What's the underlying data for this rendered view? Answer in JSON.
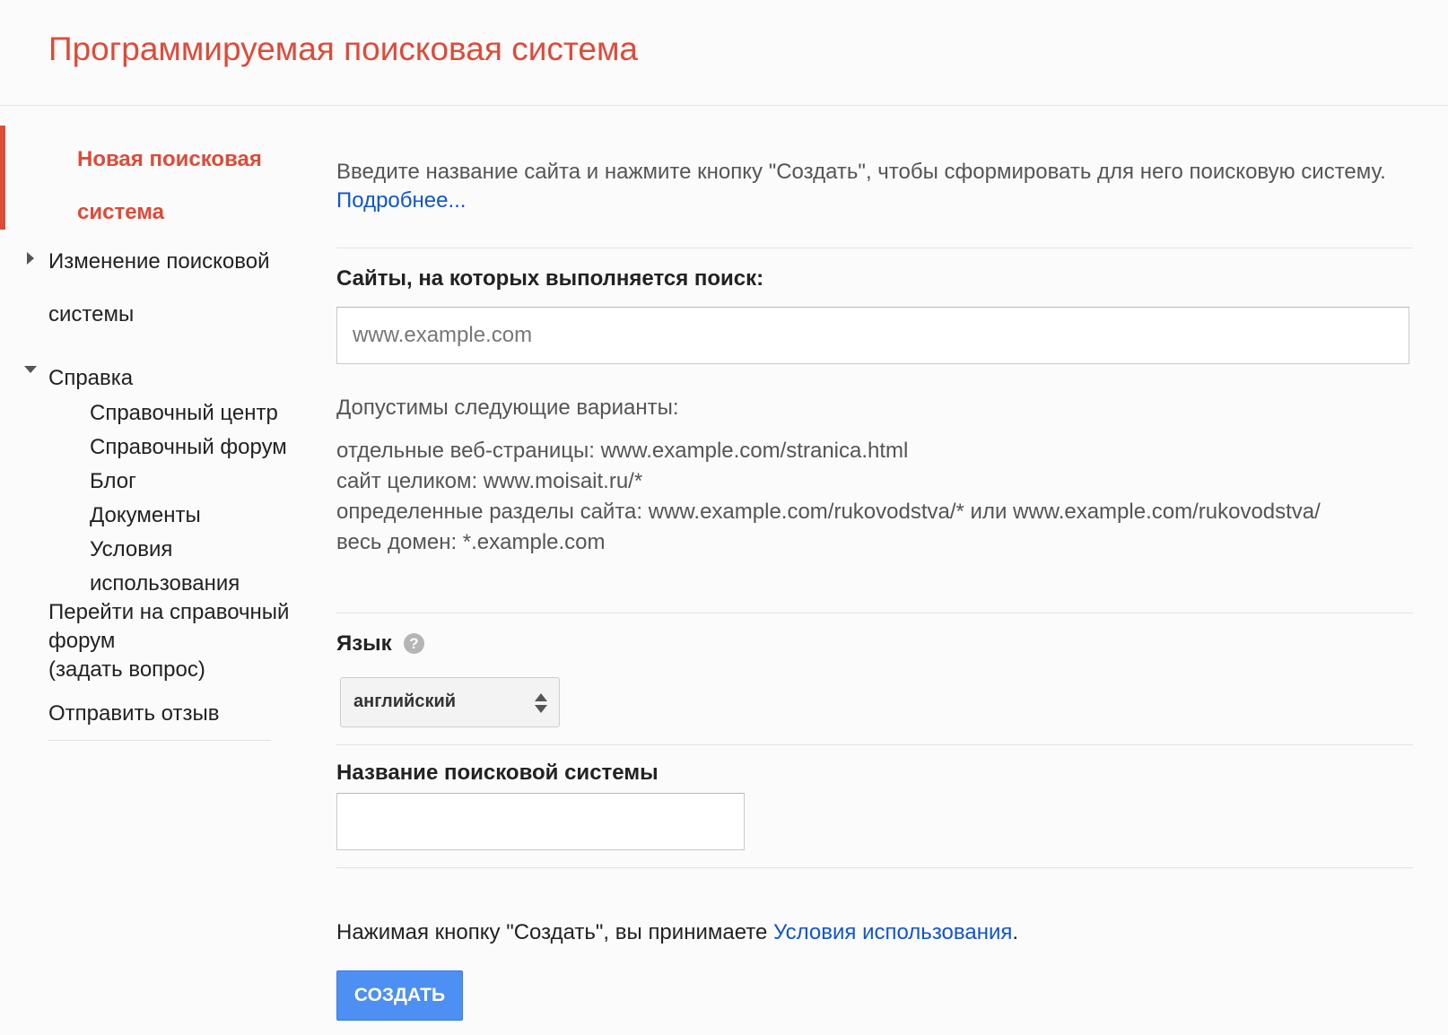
{
  "header": {
    "title": "Программируемая поисковая система"
  },
  "sidebar": {
    "new_engine": "Новая поисковая система",
    "edit_engine": "Изменение поисковой системы",
    "help": "Справка",
    "help_items": [
      "Справочный центр",
      "Справочный форум",
      "Блог",
      "Документы",
      "Условия использования"
    ],
    "goto_forum": "Перейти на справочный форум",
    "ask_question": "(задать вопрос)",
    "send_feedback": "Отправить отзыв"
  },
  "main": {
    "intro_text": "Введите название сайта и нажмите кнопку \"Создать\", чтобы сформировать для него поисковую систему.",
    "intro_link": "Подробнее...",
    "sites_label": "Сайты, на которых выполняется поиск:",
    "sites_placeholder": "www.example.com",
    "allowed_title": "Допустимы следующие варианты:",
    "allowed_items": [
      "отдельные веб-страницы: www.example.com/stranica.html",
      "сайт целиком: www.moisait.ru/*",
      "определенные разделы сайта: www.example.com/rukovodstva/* или www.example.com/rukovodstva/",
      "весь домен: *.example.com"
    ],
    "language_label": "Язык",
    "help_icon_glyph": "?",
    "language_value": "английский",
    "engine_name_label": "Название поисковой системы",
    "engine_name_value": "",
    "terms_text": "Нажимая кнопку \"Создать\", вы принимаете",
    "terms_link": "Условия использования",
    "terms_suffix": ".",
    "create_button": "СОЗДАТЬ"
  },
  "colors": {
    "brand_red": "#dd4b39",
    "link_blue": "#1155cc",
    "button_blue": "#4d8ff2"
  }
}
